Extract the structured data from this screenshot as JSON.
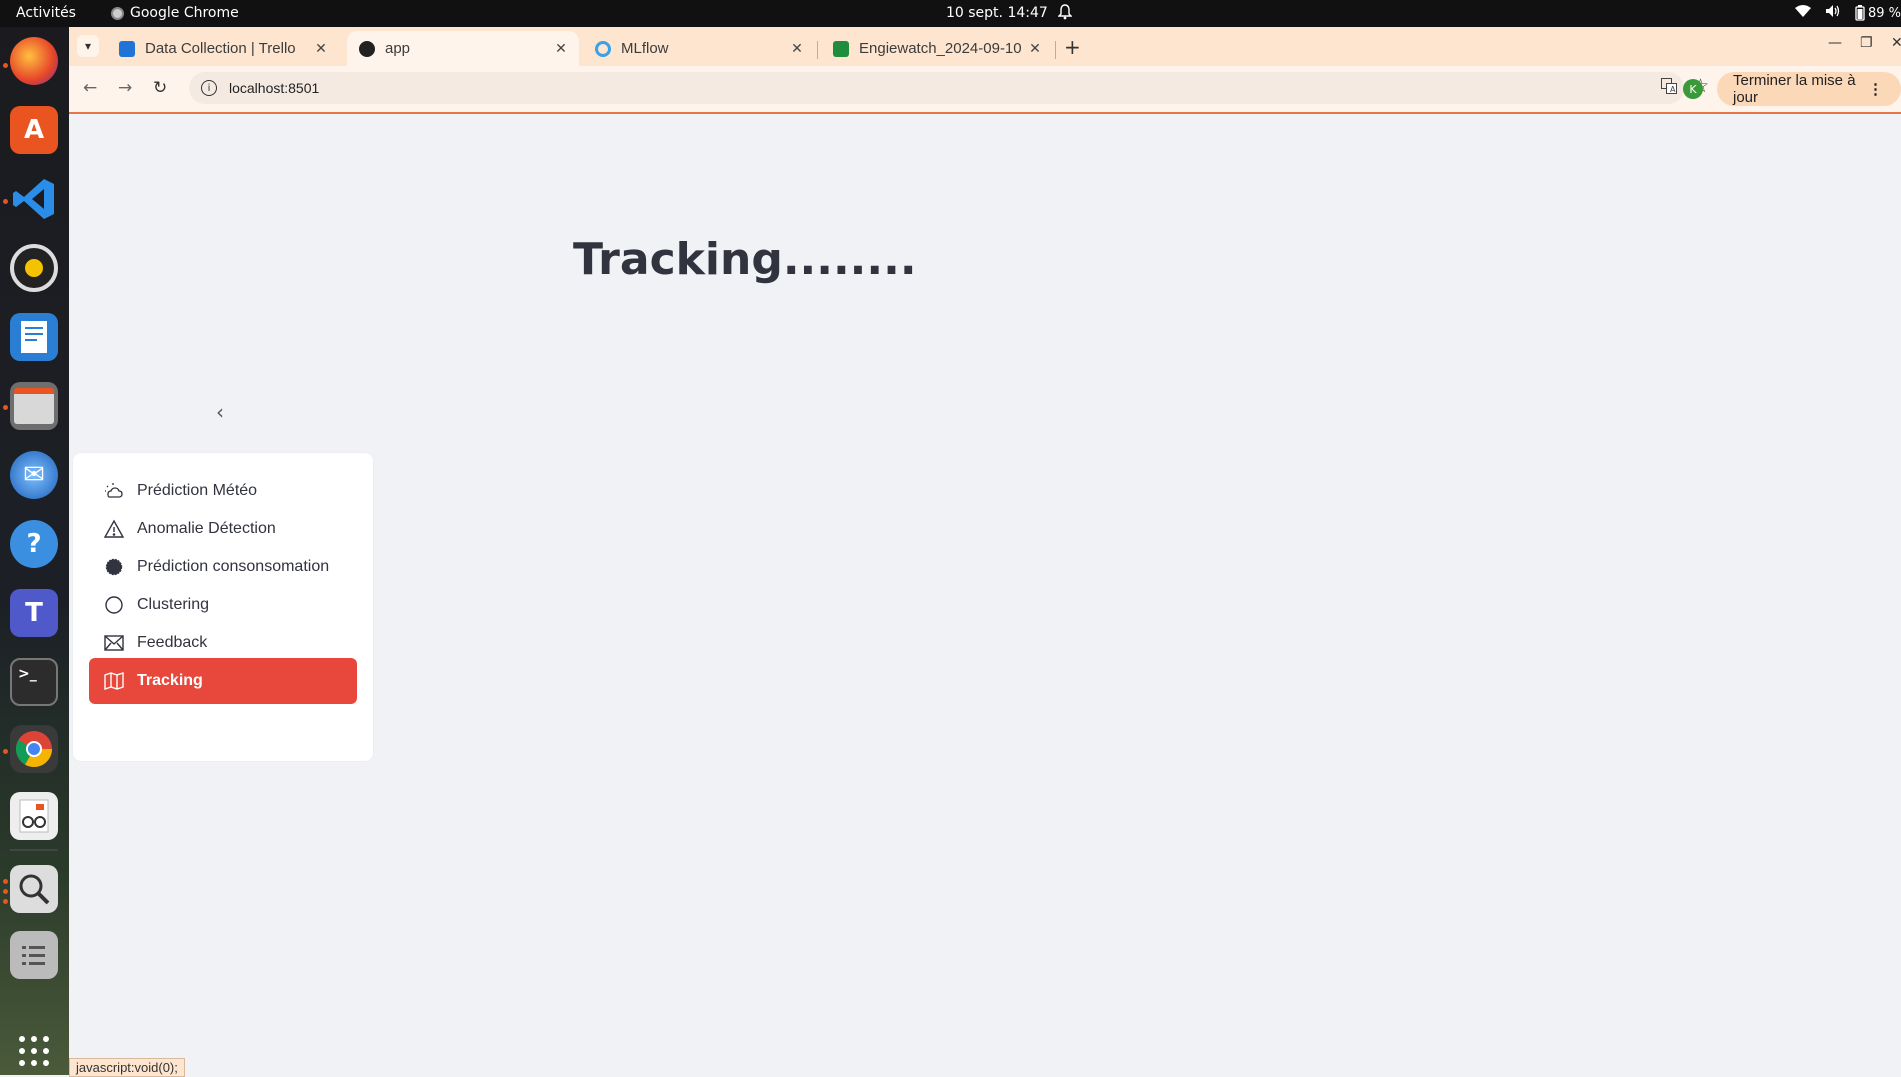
{
  "system": {
    "activities": "Activités",
    "app_name": "Google Chrome",
    "clock": "10 sept.  14:47",
    "battery": "89 %"
  },
  "browser": {
    "tabs": [
      {
        "title": "Data Collection | Trello",
        "favicon_color": "#1f74d6"
      },
      {
        "title": "app",
        "favicon_color": "#222222"
      },
      {
        "title": "MLflow",
        "favicon_color": "#3aa0e8"
      },
      {
        "title": "Engiewatch_2024-09-10",
        "favicon_color": "#1e8e3e"
      }
    ],
    "url": "localhost:8501",
    "profile_initial": "K",
    "update_button": "Terminer la mise à jour"
  },
  "page": {
    "title": "Tracking........",
    "menu": [
      {
        "label": "Prédiction Météo",
        "icon": "cloud-sun-icon"
      },
      {
        "label": "Anomalie Détection",
        "icon": "warning-triangle-icon"
      },
      {
        "label": "Prédiction consonsomation",
        "icon": "circle-filled-icon"
      },
      {
        "label": "Clustering",
        "icon": "circle-icon"
      },
      {
        "label": "Feedback",
        "icon": "envelope-icon"
      },
      {
        "label": "Tracking",
        "icon": "map-icon",
        "active": true
      }
    ],
    "accent_color": "#e8483b"
  },
  "status_bar": "javascript:void(0);"
}
